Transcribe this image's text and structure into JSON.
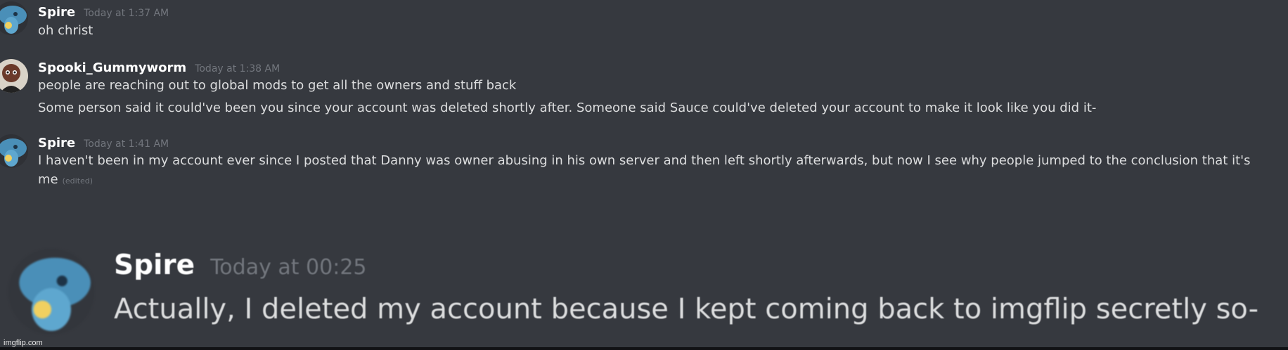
{
  "messages": [
    {
      "username": "Spire",
      "timestamp": "Today at 1:37 AM",
      "lines": [
        "oh christ"
      ]
    },
    {
      "username": "Spooki_Gummyworm",
      "timestamp": "Today at 1:38 AM",
      "lines": [
        "people are reaching out to global mods to get all the owners and stuff back",
        "Some person said it could've been you since your account was deleted shortly after. Someone said Sauce could've deleted your account to make it look like you did it-"
      ]
    },
    {
      "username": "Spire",
      "timestamp": "Today at 1:41 AM",
      "lines": [
        "I haven't been in my account ever since I posted that Danny was owner abusing in his own server and then left shortly afterwards, but now I see why people jumped to the conclusion that it's",
        "me"
      ],
      "edited_label": "(edited)"
    }
  ],
  "zoomed_message": {
    "username": "Spire",
    "timestamp": "Today at 00:25",
    "text": "Actually, I deleted my account because I kept coming back to imgflip secretly so-"
  },
  "watermark": "imgflip.com",
  "colors": {
    "background": "#36393f",
    "username": "#ffffff",
    "message_text": "#dcddde",
    "timestamp": "#72767d"
  }
}
